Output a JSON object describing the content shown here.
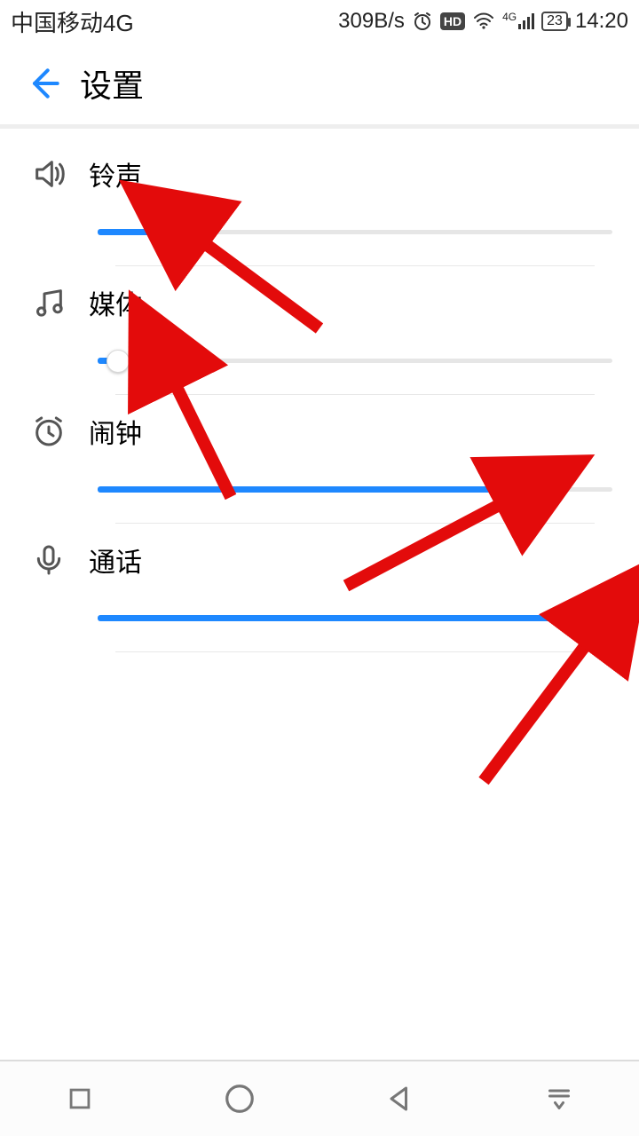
{
  "status": {
    "carrier": "中国移动4G",
    "speed": "309B/s",
    "hd": "HD",
    "signal": "4G",
    "battery": "23",
    "time": "14:20"
  },
  "header": {
    "title": "设置"
  },
  "rows": [
    {
      "label": "铃声",
      "value": 15
    },
    {
      "label": "媒体",
      "value": 4
    },
    {
      "label": "闹钟",
      "value": 84
    },
    {
      "label": "通话",
      "value": 100
    }
  ],
  "colors": {
    "accent": "#1e88ff",
    "arrow": "#e30b0b"
  }
}
